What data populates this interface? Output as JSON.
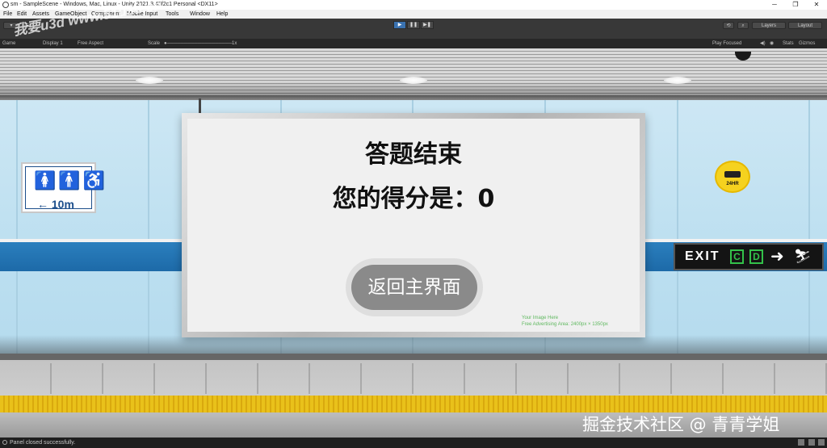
{
  "window": {
    "title": "sm - SampleScene - Windows, Mac, Linux - Unity 2021.3.45f2c1 Personal <DX11>",
    "minimize": "─",
    "maximize": "❐",
    "close": "✕"
  },
  "menubar": [
    "File",
    "Edit",
    "Assets",
    "GameObject",
    "Component",
    "Mobile Input",
    "Tools",
    "Window",
    "Help"
  ],
  "toolbar": {
    "account_label": "▾",
    "play": "▶",
    "pause": "❚❚",
    "step": "▶❚",
    "layers_label": "Layers",
    "layout_label": "Layout"
  },
  "gamebar": {
    "tab_label": "Game",
    "display_label": "Display 1",
    "aspect_label": "Free Aspect",
    "scale_label": "Scale",
    "scale_value": "1x",
    "play_mode_label": "Play Focused",
    "stats_label": "Stats",
    "gizmos_label": "Gizmos"
  },
  "scene": {
    "restroom_icons": "🚺🚹♿",
    "restroom_distance": "← 10m",
    "cctv_label": "24HR",
    "exit_label": "EXIT",
    "exit_line_c": "C",
    "exit_line_d": "D",
    "exit_arrow": "➜",
    "exit_escalator": "⛷"
  },
  "billboard": {
    "title": "答题结束",
    "score_text": "您的得分是：0",
    "button_label": "返回主界面",
    "ad_line1": "Your Image Here",
    "ad_line2": "Free Advertising Area: 2400px × 1350px"
  },
  "watermarks": {
    "top_left": "我要u3d  www.51u3d.cn",
    "bottom_right": "掘金技术社区 @ 青青学姐"
  },
  "status": {
    "message": "Panel closed successfully."
  },
  "colors": {
    "accent_blue": "#2b7fbe",
    "exit_green": "#33c14a",
    "yellow_strip": "#e9c11a"
  }
}
